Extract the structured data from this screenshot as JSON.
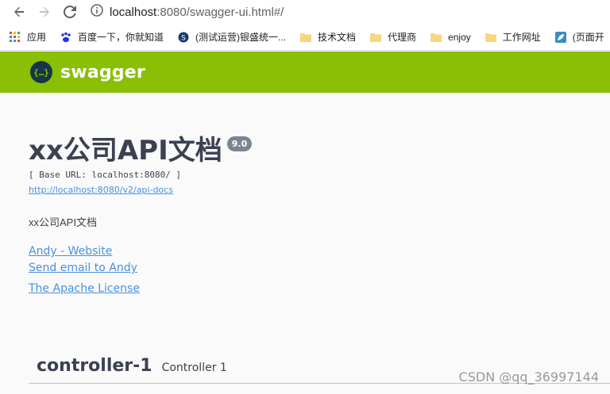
{
  "browser": {
    "url_host": "localhost",
    "url_path": ":8080/swagger-ui.html#/"
  },
  "bookmarks": [
    {
      "label": "应用",
      "icon": "apps-grid-icon"
    },
    {
      "label": "百度一下，你就知道",
      "icon": "baidu-paw-icon"
    },
    {
      "label": "(测试运营)银盛统一...",
      "icon": "site-globe-icon"
    },
    {
      "label": "技术文档",
      "icon": "folder-icon"
    },
    {
      "label": "代理商",
      "icon": "folder-icon"
    },
    {
      "label": "enjoy",
      "icon": "folder-icon"
    },
    {
      "label": "工作网址",
      "icon": "folder-icon"
    },
    {
      "label": "(页面开",
      "icon": "leaf-icon"
    }
  ],
  "swagger": {
    "logo_text": "swagger",
    "logo_glyph": "{…}",
    "accent": "#89bf04"
  },
  "info": {
    "title": "xx公司API文档",
    "version": "9.0",
    "base_url": "[ Base URL: localhost:8080/ ]",
    "api_docs_link": "http://localhost:8080/v2/api-docs",
    "description": "xx公司API文档",
    "contact_website": "Andy - Website",
    "contact_email": "Send email to Andy",
    "license": "The Apache License"
  },
  "tag": {
    "name": "controller-1",
    "description": "Controller 1"
  },
  "watermark": "CSDN @qq_36997144"
}
